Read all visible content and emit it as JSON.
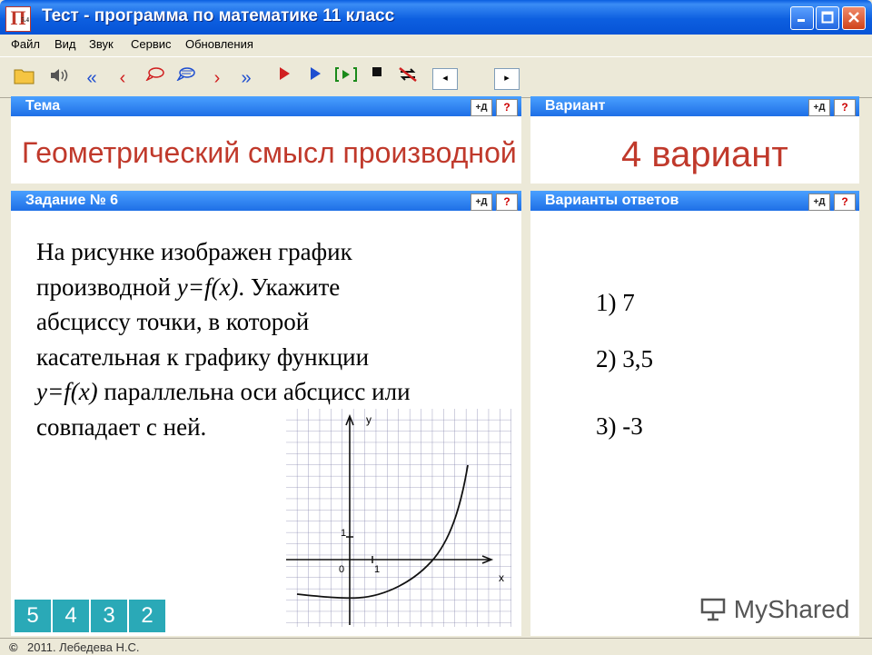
{
  "window": {
    "title": "Тест - программа по математике 11 класс",
    "icon_letter": "П",
    "icon_badge": "5.4"
  },
  "menu": [
    "Файл",
    "Вид",
    "Звук",
    "Сервис",
    "Обновления"
  ],
  "toolbar": {
    "icons": [
      "folder-icon",
      "speaker-icon",
      "first-icon",
      "prev-icon",
      "speech-bubble-icon",
      "speech-bubble-2-icon",
      "next-icon",
      "last-icon",
      "play-red-icon",
      "play-blue-icon",
      "play-bracket-icon",
      "stop-icon",
      "no-sync-icon"
    ]
  },
  "panes": {
    "topic": {
      "label": "Тема",
      "value": "Геометрический смысл производной",
      "sel": "+Д",
      "help": "?"
    },
    "variant": {
      "label": "Вариант",
      "value": "4 вариант",
      "sel": "+Д",
      "help": "?"
    },
    "task": {
      "label": "Задание №",
      "number": "6",
      "sel": "+Д",
      "help": "?"
    },
    "answers": {
      "label": "Варианты ответов",
      "sel": "+Д",
      "help": "?"
    }
  },
  "question": {
    "line1": "На рисунке изображен график",
    "line2_a": "производной ",
    "line2_b": "y=f(x)",
    "line2_c": ". Укажите",
    "line3": "абсциссу точки, в которой",
    "line4": "касательная  к графику функции",
    "line5_a": "y=f(x)",
    "line5_b": " параллельна оси абсцисс  или",
    "line6": "совпадает с ней."
  },
  "answers": [
    "1) 7",
    "2) 3,5",
    "3) -3"
  ],
  "graph": {
    "y_label": "y",
    "x_label": "x",
    "origin": "0",
    "x_tick": "1",
    "y_tick": "1"
  },
  "grades": [
    "5",
    "4",
    "3",
    "2"
  ],
  "status": {
    "copyright": "©",
    "text": "2011. Лебедева Н.С."
  },
  "watermark": "MyShared",
  "colors": {
    "accent_red": "#c0392b",
    "header_blue": "#1e6fe6",
    "grade_teal": "#2aa9b7"
  }
}
